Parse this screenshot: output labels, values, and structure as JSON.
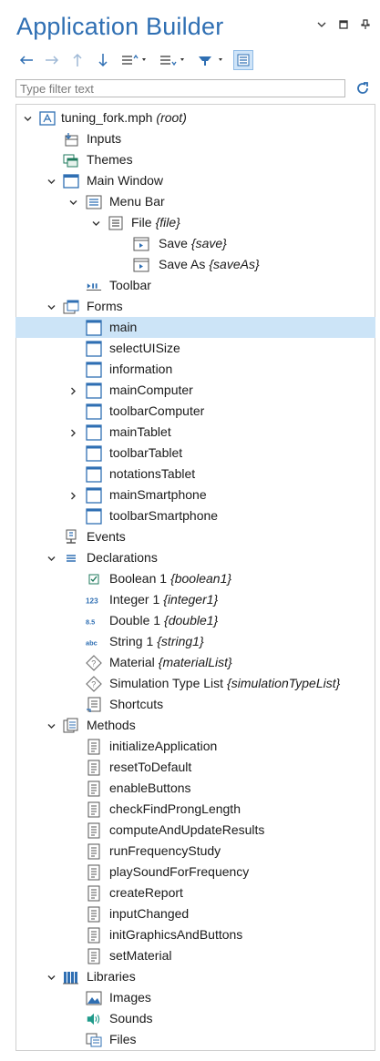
{
  "header": {
    "title": "Application Builder"
  },
  "filter": {
    "placeholder": "Type filter text"
  },
  "colors": {
    "accent": "#2f6fb3",
    "selection": "#cce4f7"
  },
  "tree": [
    {
      "level": 0,
      "expander": "expanded",
      "icon": "app-icon",
      "label": "tuning_fork.mph",
      "tag": "(root)"
    },
    {
      "level": 1,
      "expander": "none",
      "icon": "inputs-icon",
      "label": "Inputs",
      "tag": ""
    },
    {
      "level": 1,
      "expander": "none",
      "icon": "themes-icon",
      "label": "Themes",
      "tag": ""
    },
    {
      "level": 1,
      "expander": "expanded",
      "icon": "window-icon",
      "label": "Main Window",
      "tag": ""
    },
    {
      "level": 2,
      "expander": "expanded",
      "icon": "menubar-icon",
      "label": "Menu Bar",
      "tag": ""
    },
    {
      "level": 3,
      "expander": "expanded",
      "icon": "menu-icon",
      "label": "File",
      "tag": "{file}"
    },
    {
      "level": 4,
      "expander": "none",
      "icon": "menu-item-icon",
      "label": "Save",
      "tag": "{save}"
    },
    {
      "level": 4,
      "expander": "none",
      "icon": "menu-item-icon",
      "label": "Save As",
      "tag": "{saveAs}"
    },
    {
      "level": 2,
      "expander": "none",
      "icon": "toolbar-icon",
      "label": "Toolbar",
      "tag": ""
    },
    {
      "level": 1,
      "expander": "expanded",
      "icon": "forms-icon",
      "label": "Forms",
      "tag": ""
    },
    {
      "level": 2,
      "expander": "none",
      "icon": "form-icon",
      "label": "main",
      "tag": "",
      "selected": true
    },
    {
      "level": 2,
      "expander": "none",
      "icon": "form-icon",
      "label": "selectUISize",
      "tag": ""
    },
    {
      "level": 2,
      "expander": "none",
      "icon": "form-icon",
      "label": "information",
      "tag": ""
    },
    {
      "level": 2,
      "expander": "collapsed",
      "icon": "form-icon",
      "label": "mainComputer",
      "tag": ""
    },
    {
      "level": 2,
      "expander": "none",
      "icon": "form-icon",
      "label": "toolbarComputer",
      "tag": ""
    },
    {
      "level": 2,
      "expander": "collapsed",
      "icon": "form-icon",
      "label": "mainTablet",
      "tag": ""
    },
    {
      "level": 2,
      "expander": "none",
      "icon": "form-icon",
      "label": "toolbarTablet",
      "tag": ""
    },
    {
      "level": 2,
      "expander": "none",
      "icon": "form-icon",
      "label": "notationsTablet",
      "tag": ""
    },
    {
      "level": 2,
      "expander": "collapsed",
      "icon": "form-icon",
      "label": "mainSmartphone",
      "tag": ""
    },
    {
      "level": 2,
      "expander": "none",
      "icon": "form-icon",
      "label": "toolbarSmartphone",
      "tag": ""
    },
    {
      "level": 1,
      "expander": "none",
      "icon": "events-icon",
      "label": "Events",
      "tag": ""
    },
    {
      "level": 1,
      "expander": "expanded",
      "icon": "declarations-icon",
      "label": "Declarations",
      "tag": ""
    },
    {
      "level": 2,
      "expander": "none",
      "icon": "boolean-icon",
      "label": "Boolean 1",
      "tag": "{boolean1}"
    },
    {
      "level": 2,
      "expander": "none",
      "icon": "integer-icon",
      "label": "Integer 1",
      "tag": "{integer1}"
    },
    {
      "level": 2,
      "expander": "none",
      "icon": "double-icon",
      "label": "Double 1",
      "tag": "{double1}"
    },
    {
      "level": 2,
      "expander": "none",
      "icon": "string-icon",
      "label": "String 1",
      "tag": "{string1}"
    },
    {
      "level": 2,
      "expander": "none",
      "icon": "choice-list-icon",
      "label": "Material",
      "tag": "{materialList}"
    },
    {
      "level": 2,
      "expander": "none",
      "icon": "choice-list-icon",
      "label": "Simulation Type List",
      "tag": "{simulationTypeList}"
    },
    {
      "level": 2,
      "expander": "none",
      "icon": "shortcuts-icon",
      "label": "Shortcuts",
      "tag": ""
    },
    {
      "level": 1,
      "expander": "expanded",
      "icon": "methods-icon",
      "label": "Methods",
      "tag": ""
    },
    {
      "level": 2,
      "expander": "none",
      "icon": "method-icon",
      "label": "initializeApplication",
      "tag": ""
    },
    {
      "level": 2,
      "expander": "none",
      "icon": "method-icon",
      "label": "resetToDefault",
      "tag": ""
    },
    {
      "level": 2,
      "expander": "none",
      "icon": "method-icon",
      "label": "enableButtons",
      "tag": ""
    },
    {
      "level": 2,
      "expander": "none",
      "icon": "method-icon",
      "label": "checkFindProngLength",
      "tag": ""
    },
    {
      "level": 2,
      "expander": "none",
      "icon": "method-icon",
      "label": "computeAndUpdateResults",
      "tag": ""
    },
    {
      "level": 2,
      "expander": "none",
      "icon": "method-icon",
      "label": "runFrequencyStudy",
      "tag": ""
    },
    {
      "level": 2,
      "expander": "none",
      "icon": "method-icon",
      "label": "playSoundForFrequency",
      "tag": ""
    },
    {
      "level": 2,
      "expander": "none",
      "icon": "method-icon",
      "label": "createReport",
      "tag": ""
    },
    {
      "level": 2,
      "expander": "none",
      "icon": "method-icon",
      "label": "inputChanged",
      "tag": ""
    },
    {
      "level": 2,
      "expander": "none",
      "icon": "method-icon",
      "label": "initGraphicsAndButtons",
      "tag": ""
    },
    {
      "level": 2,
      "expander": "none",
      "icon": "method-icon",
      "label": "setMaterial",
      "tag": ""
    },
    {
      "level": 1,
      "expander": "expanded",
      "icon": "libraries-icon",
      "label": "Libraries",
      "tag": ""
    },
    {
      "level": 2,
      "expander": "none",
      "icon": "images-icon",
      "label": "Images",
      "tag": ""
    },
    {
      "level": 2,
      "expander": "none",
      "icon": "sounds-icon",
      "label": "Sounds",
      "tag": ""
    },
    {
      "level": 2,
      "expander": "none",
      "icon": "files-icon",
      "label": "Files",
      "tag": ""
    }
  ]
}
